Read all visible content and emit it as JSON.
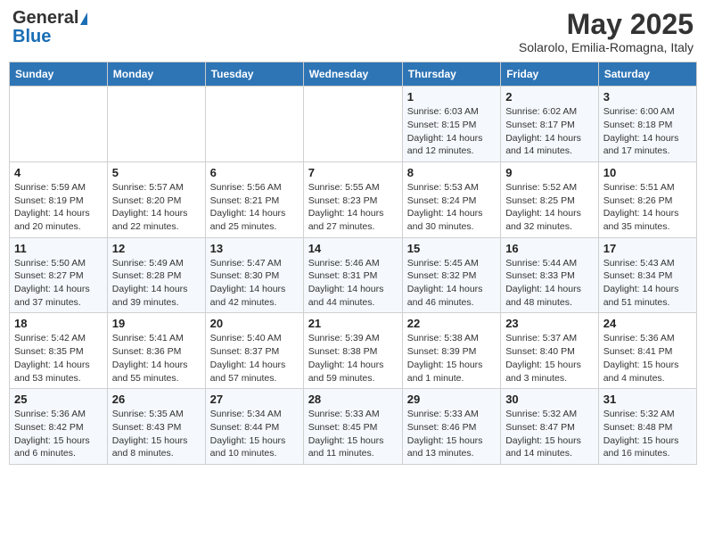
{
  "header": {
    "logo_general": "General",
    "logo_blue": "Blue",
    "month_title": "May 2025",
    "subtitle": "Solarolo, Emilia-Romagna, Italy"
  },
  "days_of_week": [
    "Sunday",
    "Monday",
    "Tuesday",
    "Wednesday",
    "Thursday",
    "Friday",
    "Saturday"
  ],
  "weeks": [
    [
      {
        "day": "",
        "info": ""
      },
      {
        "day": "",
        "info": ""
      },
      {
        "day": "",
        "info": ""
      },
      {
        "day": "",
        "info": ""
      },
      {
        "day": "1",
        "info": "Sunrise: 6:03 AM\nSunset: 8:15 PM\nDaylight: 14 hours\nand 12 minutes."
      },
      {
        "day": "2",
        "info": "Sunrise: 6:02 AM\nSunset: 8:17 PM\nDaylight: 14 hours\nand 14 minutes."
      },
      {
        "day": "3",
        "info": "Sunrise: 6:00 AM\nSunset: 8:18 PM\nDaylight: 14 hours\nand 17 minutes."
      }
    ],
    [
      {
        "day": "4",
        "info": "Sunrise: 5:59 AM\nSunset: 8:19 PM\nDaylight: 14 hours\nand 20 minutes."
      },
      {
        "day": "5",
        "info": "Sunrise: 5:57 AM\nSunset: 8:20 PM\nDaylight: 14 hours\nand 22 minutes."
      },
      {
        "day": "6",
        "info": "Sunrise: 5:56 AM\nSunset: 8:21 PM\nDaylight: 14 hours\nand 25 minutes."
      },
      {
        "day": "7",
        "info": "Sunrise: 5:55 AM\nSunset: 8:23 PM\nDaylight: 14 hours\nand 27 minutes."
      },
      {
        "day": "8",
        "info": "Sunrise: 5:53 AM\nSunset: 8:24 PM\nDaylight: 14 hours\nand 30 minutes."
      },
      {
        "day": "9",
        "info": "Sunrise: 5:52 AM\nSunset: 8:25 PM\nDaylight: 14 hours\nand 32 minutes."
      },
      {
        "day": "10",
        "info": "Sunrise: 5:51 AM\nSunset: 8:26 PM\nDaylight: 14 hours\nand 35 minutes."
      }
    ],
    [
      {
        "day": "11",
        "info": "Sunrise: 5:50 AM\nSunset: 8:27 PM\nDaylight: 14 hours\nand 37 minutes."
      },
      {
        "day": "12",
        "info": "Sunrise: 5:49 AM\nSunset: 8:28 PM\nDaylight: 14 hours\nand 39 minutes."
      },
      {
        "day": "13",
        "info": "Sunrise: 5:47 AM\nSunset: 8:30 PM\nDaylight: 14 hours\nand 42 minutes."
      },
      {
        "day": "14",
        "info": "Sunrise: 5:46 AM\nSunset: 8:31 PM\nDaylight: 14 hours\nand 44 minutes."
      },
      {
        "day": "15",
        "info": "Sunrise: 5:45 AM\nSunset: 8:32 PM\nDaylight: 14 hours\nand 46 minutes."
      },
      {
        "day": "16",
        "info": "Sunrise: 5:44 AM\nSunset: 8:33 PM\nDaylight: 14 hours\nand 48 minutes."
      },
      {
        "day": "17",
        "info": "Sunrise: 5:43 AM\nSunset: 8:34 PM\nDaylight: 14 hours\nand 51 minutes."
      }
    ],
    [
      {
        "day": "18",
        "info": "Sunrise: 5:42 AM\nSunset: 8:35 PM\nDaylight: 14 hours\nand 53 minutes."
      },
      {
        "day": "19",
        "info": "Sunrise: 5:41 AM\nSunset: 8:36 PM\nDaylight: 14 hours\nand 55 minutes."
      },
      {
        "day": "20",
        "info": "Sunrise: 5:40 AM\nSunset: 8:37 PM\nDaylight: 14 hours\nand 57 minutes."
      },
      {
        "day": "21",
        "info": "Sunrise: 5:39 AM\nSunset: 8:38 PM\nDaylight: 14 hours\nand 59 minutes."
      },
      {
        "day": "22",
        "info": "Sunrise: 5:38 AM\nSunset: 8:39 PM\nDaylight: 15 hours\nand 1 minute."
      },
      {
        "day": "23",
        "info": "Sunrise: 5:37 AM\nSunset: 8:40 PM\nDaylight: 15 hours\nand 3 minutes."
      },
      {
        "day": "24",
        "info": "Sunrise: 5:36 AM\nSunset: 8:41 PM\nDaylight: 15 hours\nand 4 minutes."
      }
    ],
    [
      {
        "day": "25",
        "info": "Sunrise: 5:36 AM\nSunset: 8:42 PM\nDaylight: 15 hours\nand 6 minutes."
      },
      {
        "day": "26",
        "info": "Sunrise: 5:35 AM\nSunset: 8:43 PM\nDaylight: 15 hours\nand 8 minutes."
      },
      {
        "day": "27",
        "info": "Sunrise: 5:34 AM\nSunset: 8:44 PM\nDaylight: 15 hours\nand 10 minutes."
      },
      {
        "day": "28",
        "info": "Sunrise: 5:33 AM\nSunset: 8:45 PM\nDaylight: 15 hours\nand 11 minutes."
      },
      {
        "day": "29",
        "info": "Sunrise: 5:33 AM\nSunset: 8:46 PM\nDaylight: 15 hours\nand 13 minutes."
      },
      {
        "day": "30",
        "info": "Sunrise: 5:32 AM\nSunset: 8:47 PM\nDaylight: 15 hours\nand 14 minutes."
      },
      {
        "day": "31",
        "info": "Sunrise: 5:32 AM\nSunset: 8:48 PM\nDaylight: 15 hours\nand 16 minutes."
      }
    ]
  ]
}
